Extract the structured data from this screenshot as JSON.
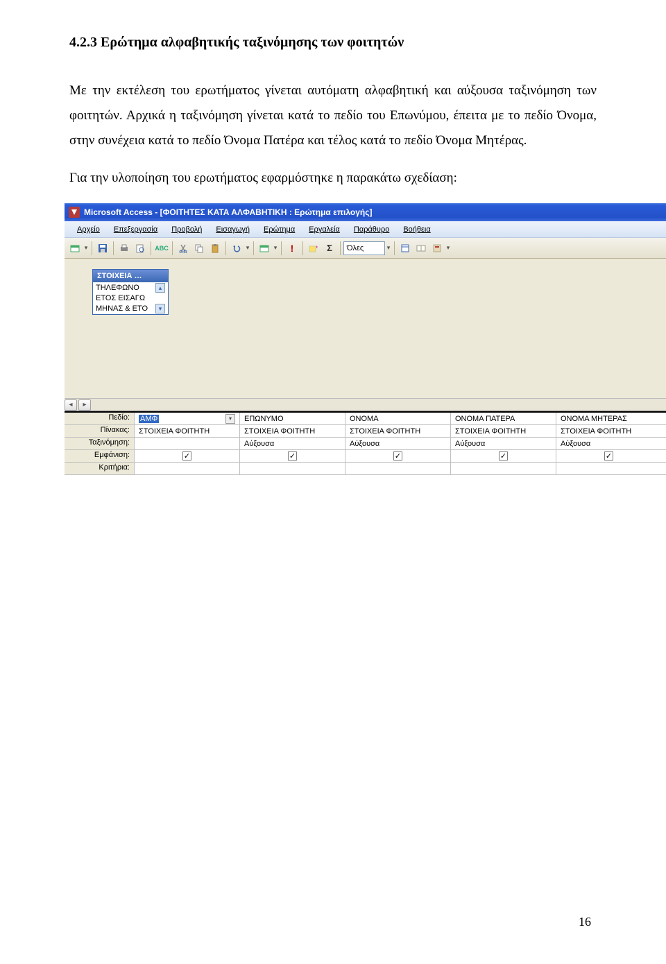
{
  "doc": {
    "heading": "4.2.3 Ερώτημα αλφαβητικής ταξινόμησης των φοιτητών",
    "para1": "Με την εκτέλεση του ερωτήματος γίνεται αυτόματη αλφαβητική και αύξουσα ταξινόμηση των φοιτητών. Αρχικά η ταξινόμηση γίνεται κατά το πεδίο του Επωνύμου, έπειτα με το πεδίο Όνομα, στην συνέχεια κατά το πεδίο Όνομα Πατέρα και τέλος κατά το πεδίο Όνομα Μητέρας.",
    "para2": "Για την υλοποίηση του ερωτήματος εφαρμόστηκε η παρακάτω σχεδίαση:",
    "page_number": "16"
  },
  "app": {
    "title": "Microsoft Access - [ΦΟΙΤΗΤΕΣ ΚΑΤΑ ΑΛΦΑΒΗΤΙΚΗ : Ερώτημα επιλογής]",
    "menus": [
      "Αρχείο",
      "Επεξεργασία",
      "Προβολή",
      "Εισαγωγή",
      "Ερώτημα",
      "Εργαλεία",
      "Παράθυρο",
      "Βοήθεια"
    ],
    "sigma": "Σ",
    "all": "Όλες",
    "fieldbox": {
      "title": "ΣΤΟΙΧΕΙΑ …",
      "rows": [
        "ΤΗΛΕΦΩΝΟ",
        "ΕΤΟΣ ΕΙΣΑΓΩ",
        "ΜΗΝΑΣ & ΕΤΟ"
      ]
    },
    "grid": {
      "labels": [
        "Πεδίο:",
        "Πίνακας:",
        "Ταξινόμηση:",
        "Εμφάνιση:",
        "Κριτήρια:"
      ],
      "cols": [
        {
          "field": "ΑΜΦ",
          "table": "ΣΤΟΙΧΕΙΑ ΦΟΙΤΗΤΗ",
          "sort": "",
          "show": true,
          "selected": true
        },
        {
          "field": "ΕΠΩΝΥΜΟ",
          "table": "ΣΤΟΙΧΕΙΑ ΦΟΙΤΗΤΗ",
          "sort": "Αύξουσα",
          "show": true
        },
        {
          "field": "ΟΝΟΜΑ",
          "table": "ΣΤΟΙΧΕΙΑ ΦΟΙΤΗΤΗ",
          "sort": "Αύξουσα",
          "show": true
        },
        {
          "field": "ΟΝΟΜΑ ΠΑΤΕΡΑ",
          "table": "ΣΤΟΙΧΕΙΑ ΦΟΙΤΗΤΗ",
          "sort": "Αύξουσα",
          "show": true
        },
        {
          "field": "ΟΝΟΜΑ ΜΗΤΕΡΑΣ",
          "table": "ΣΤΟΙΧΕΙΑ ΦΟΙΤΗΤΗ",
          "sort": "Αύξουσα",
          "show": true
        }
      ]
    }
  }
}
